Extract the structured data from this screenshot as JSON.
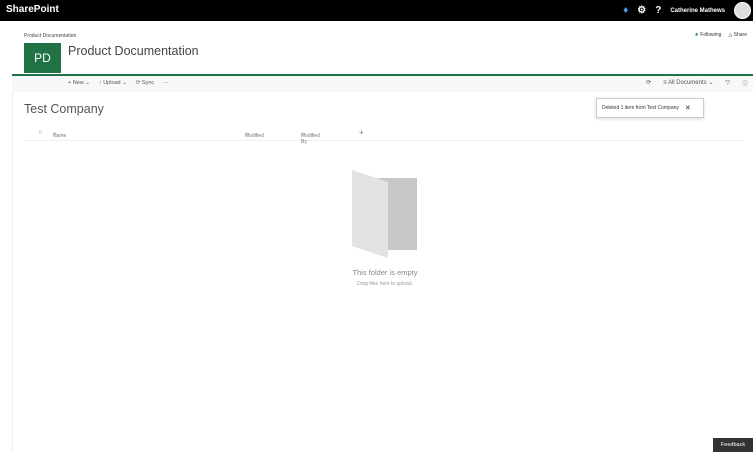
{
  "app": {
    "name": "SharePoint"
  },
  "topbar": {
    "user": "Catherine Mathews",
    "help": "?"
  },
  "site": {
    "breadcrumb": "Product Documentation",
    "logo": "PD",
    "title": "Product Documentation",
    "following": "Following",
    "share": "Share"
  },
  "commandbar": {
    "new": "New",
    "upload": "Upload",
    "sync": "Sync",
    "more": "···",
    "view": "All Documents"
  },
  "notification": {
    "text": "Deleted 1 item from Test Company"
  },
  "library": {
    "title": "Test Company",
    "columns": [
      "Name",
      "Modified",
      "Modified By"
    ],
    "add_column": "+"
  },
  "empty": {
    "title": "This folder is empty",
    "subtitle": "Drag files here to upload."
  },
  "feedback": "Feedback",
  "colors": {
    "accent": "#217346",
    "topbar": "#000000"
  }
}
